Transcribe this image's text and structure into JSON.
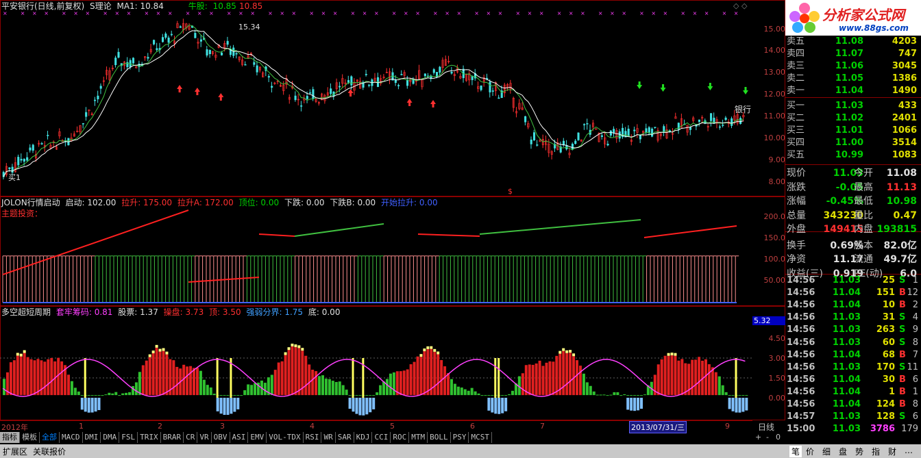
{
  "main_chart": {
    "title": "平安银行(日线,前复权)",
    "indicator": "S理论",
    "ma1": "MA1: 10.84",
    "niugu_label": "牛股: ",
    "niugu_v1": "10.85",
    "niugu_v2": "10.85",
    "high_label": "15.34",
    "price_axis": [
      "15.00",
      "14.00",
      "13.00",
      "12.00",
      "11.00",
      "10.00",
      "9.00",
      "8.00"
    ],
    "annotation_bank": "银行",
    "annotation_maiyi": "买1",
    "dollar": "$"
  },
  "panel2": {
    "name": "JOLON行情启动",
    "qidong": "启动: 102.00",
    "lasheng": "拉升: 175.00",
    "lashengA": "拉升A: 172.00",
    "dingwei": "顶位: 0.00",
    "xiadie": "下跌: 0.00",
    "xiadieB": "下跌B: 0.00",
    "kaishi": "开始拉升: 0.00",
    "zhuti": "主题投资：",
    "axis": [
      "200.0",
      "150.0",
      "100.0",
      "50.00"
    ]
  },
  "panel3": {
    "name": "多空超短周期",
    "taolao": "套牢筹码: 0.81",
    "gupiao": "股票: 1.37",
    "caopan": "操盘: 3.73",
    "ding": "顶: 3.50",
    "qiangruo": "强弱分界: 1.75",
    "di": "底: 0.00",
    "axis": [
      "4.50",
      "3.00",
      "1.50",
      "0.00"
    ],
    "current_value": "5.32"
  },
  "time_axis": {
    "year": "2012年",
    "months": [
      "1",
      "2",
      "3",
      "4",
      "5",
      "6",
      "7",
      "8",
      "9"
    ],
    "date_highlight": "2013/07/31/三",
    "period": "日线"
  },
  "tabs": [
    "指标",
    "模板",
    "全部",
    "MACD",
    "DMI",
    "DMA",
    "FSL",
    "TRIX",
    "BRAR",
    "CR",
    "VR",
    "OBV",
    "ASI",
    "EMV",
    "VOL-TDX",
    "RSI",
    "WR",
    "SAR",
    "KDJ",
    "CCI",
    "ROC",
    "MTM",
    "BOLL",
    "PSY",
    "MCST"
  ],
  "zoom": {
    "plus": "+",
    "minus": "-",
    "zero": "0"
  },
  "bottom_left": [
    "扩展区",
    "关联报价"
  ],
  "bottom_right": [
    "笔",
    "价",
    "细",
    "盘",
    "势",
    "指",
    "财",
    "…"
  ],
  "logo": {
    "text": "分析家公式网",
    "url": "www.88gs.com"
  },
  "order_book": [
    {
      "label": "卖五",
      "price": "11.08",
      "vol": "4203"
    },
    {
      "label": "卖四",
      "price": "11.07",
      "vol": "747"
    },
    {
      "label": "卖三",
      "price": "11.06",
      "vol": "3045"
    },
    {
      "label": "卖二",
      "price": "11.05",
      "vol": "1386"
    },
    {
      "label": "卖一",
      "price": "11.04",
      "vol": "1490"
    },
    {
      "label": "买一",
      "price": "11.03",
      "vol": "433"
    },
    {
      "label": "买二",
      "price": "11.02",
      "vol": "2401"
    },
    {
      "label": "买三",
      "price": "11.01",
      "vol": "1066"
    },
    {
      "label": "买四",
      "price": "11.00",
      "vol": "3514"
    },
    {
      "label": "买五",
      "price": "10.99",
      "vol": "1083"
    }
  ],
  "stats": [
    {
      "a": "现价",
      "b": "11.03",
      "c": "今开",
      "d": "11.08",
      "bc": "green",
      "dc": "white"
    },
    {
      "a": "涨跌",
      "b": "-0.05",
      "c": "最高",
      "d": "11.13",
      "bc": "green",
      "dc": "red"
    },
    {
      "a": "涨幅",
      "b": "-0.45%",
      "c": "最低",
      "d": "10.98",
      "bc": "green",
      "dc": "green"
    },
    {
      "a": "总量",
      "b": "343230",
      "c": "量比",
      "d": "0.47",
      "bc": "yellow",
      "dc": "yellow"
    },
    {
      "a": "外盘",
      "b": "149415",
      "c": "内盘",
      "d": "193815",
      "bc": "red",
      "dc": "green"
    },
    {
      "a": "换手",
      "b": "0.69%",
      "c": "股本",
      "d": "82.0亿",
      "bc": "white",
      "dc": "white"
    },
    {
      "a": "净资",
      "b": "11.17",
      "c": "流通",
      "d": "49.7亿",
      "bc": "white",
      "dc": "white"
    },
    {
      "a": "收益(三)",
      "b": "0.919",
      "c": "PE(动)",
      "d": "6.0",
      "bc": "white",
      "dc": "white"
    }
  ],
  "ticks": [
    {
      "t": "14:56",
      "p": "11.03",
      "v": "25",
      "s": "S",
      "n": "1",
      "pc": "green",
      "sc": "green"
    },
    {
      "t": "14:56",
      "p": "11.04",
      "v": "151",
      "s": "B",
      "n": "12",
      "pc": "green",
      "sc": "red"
    },
    {
      "t": "14:56",
      "p": "11.04",
      "v": "10",
      "s": "B",
      "n": "2",
      "pc": "green",
      "sc": "red"
    },
    {
      "t": "14:56",
      "p": "11.03",
      "v": "31",
      "s": "S",
      "n": "4",
      "pc": "green",
      "sc": "green"
    },
    {
      "t": "14:56",
      "p": "11.03",
      "v": "263",
      "s": "S",
      "n": "9",
      "pc": "green",
      "sc": "green"
    },
    {
      "t": "14:56",
      "p": "11.03",
      "v": "60",
      "s": "S",
      "n": "8",
      "pc": "green",
      "sc": "green"
    },
    {
      "t": "14:56",
      "p": "11.04",
      "v": "68",
      "s": "B",
      "n": "7",
      "pc": "green",
      "sc": "red"
    },
    {
      "t": "14:56",
      "p": "11.03",
      "v": "170",
      "s": "S",
      "n": "11",
      "pc": "green",
      "sc": "green"
    },
    {
      "t": "14:56",
      "p": "11.04",
      "v": "30",
      "s": "B",
      "n": "6",
      "pc": "green",
      "sc": "red"
    },
    {
      "t": "14:56",
      "p": "11.04",
      "v": "1",
      "s": "B",
      "n": "1",
      "pc": "green",
      "sc": "red"
    },
    {
      "t": "14:56",
      "p": "11.04",
      "v": "124",
      "s": "B",
      "n": "8",
      "pc": "green",
      "sc": "red"
    },
    {
      "t": "14:57",
      "p": "11.03",
      "v": "128",
      "s": "S",
      "n": "6",
      "pc": "green",
      "sc": "green"
    },
    {
      "t": "15:00",
      "p": "11.03",
      "v": "3786",
      "s": "",
      "n": "179",
      "pc": "green",
      "sc": "green"
    }
  ],
  "colors": {
    "up": "#ff3030",
    "down": "#00d000",
    "ma": "#ffffff",
    "ma2": "#40c040",
    "magenta": "#ff40ff",
    "axis": "#c04040"
  }
}
